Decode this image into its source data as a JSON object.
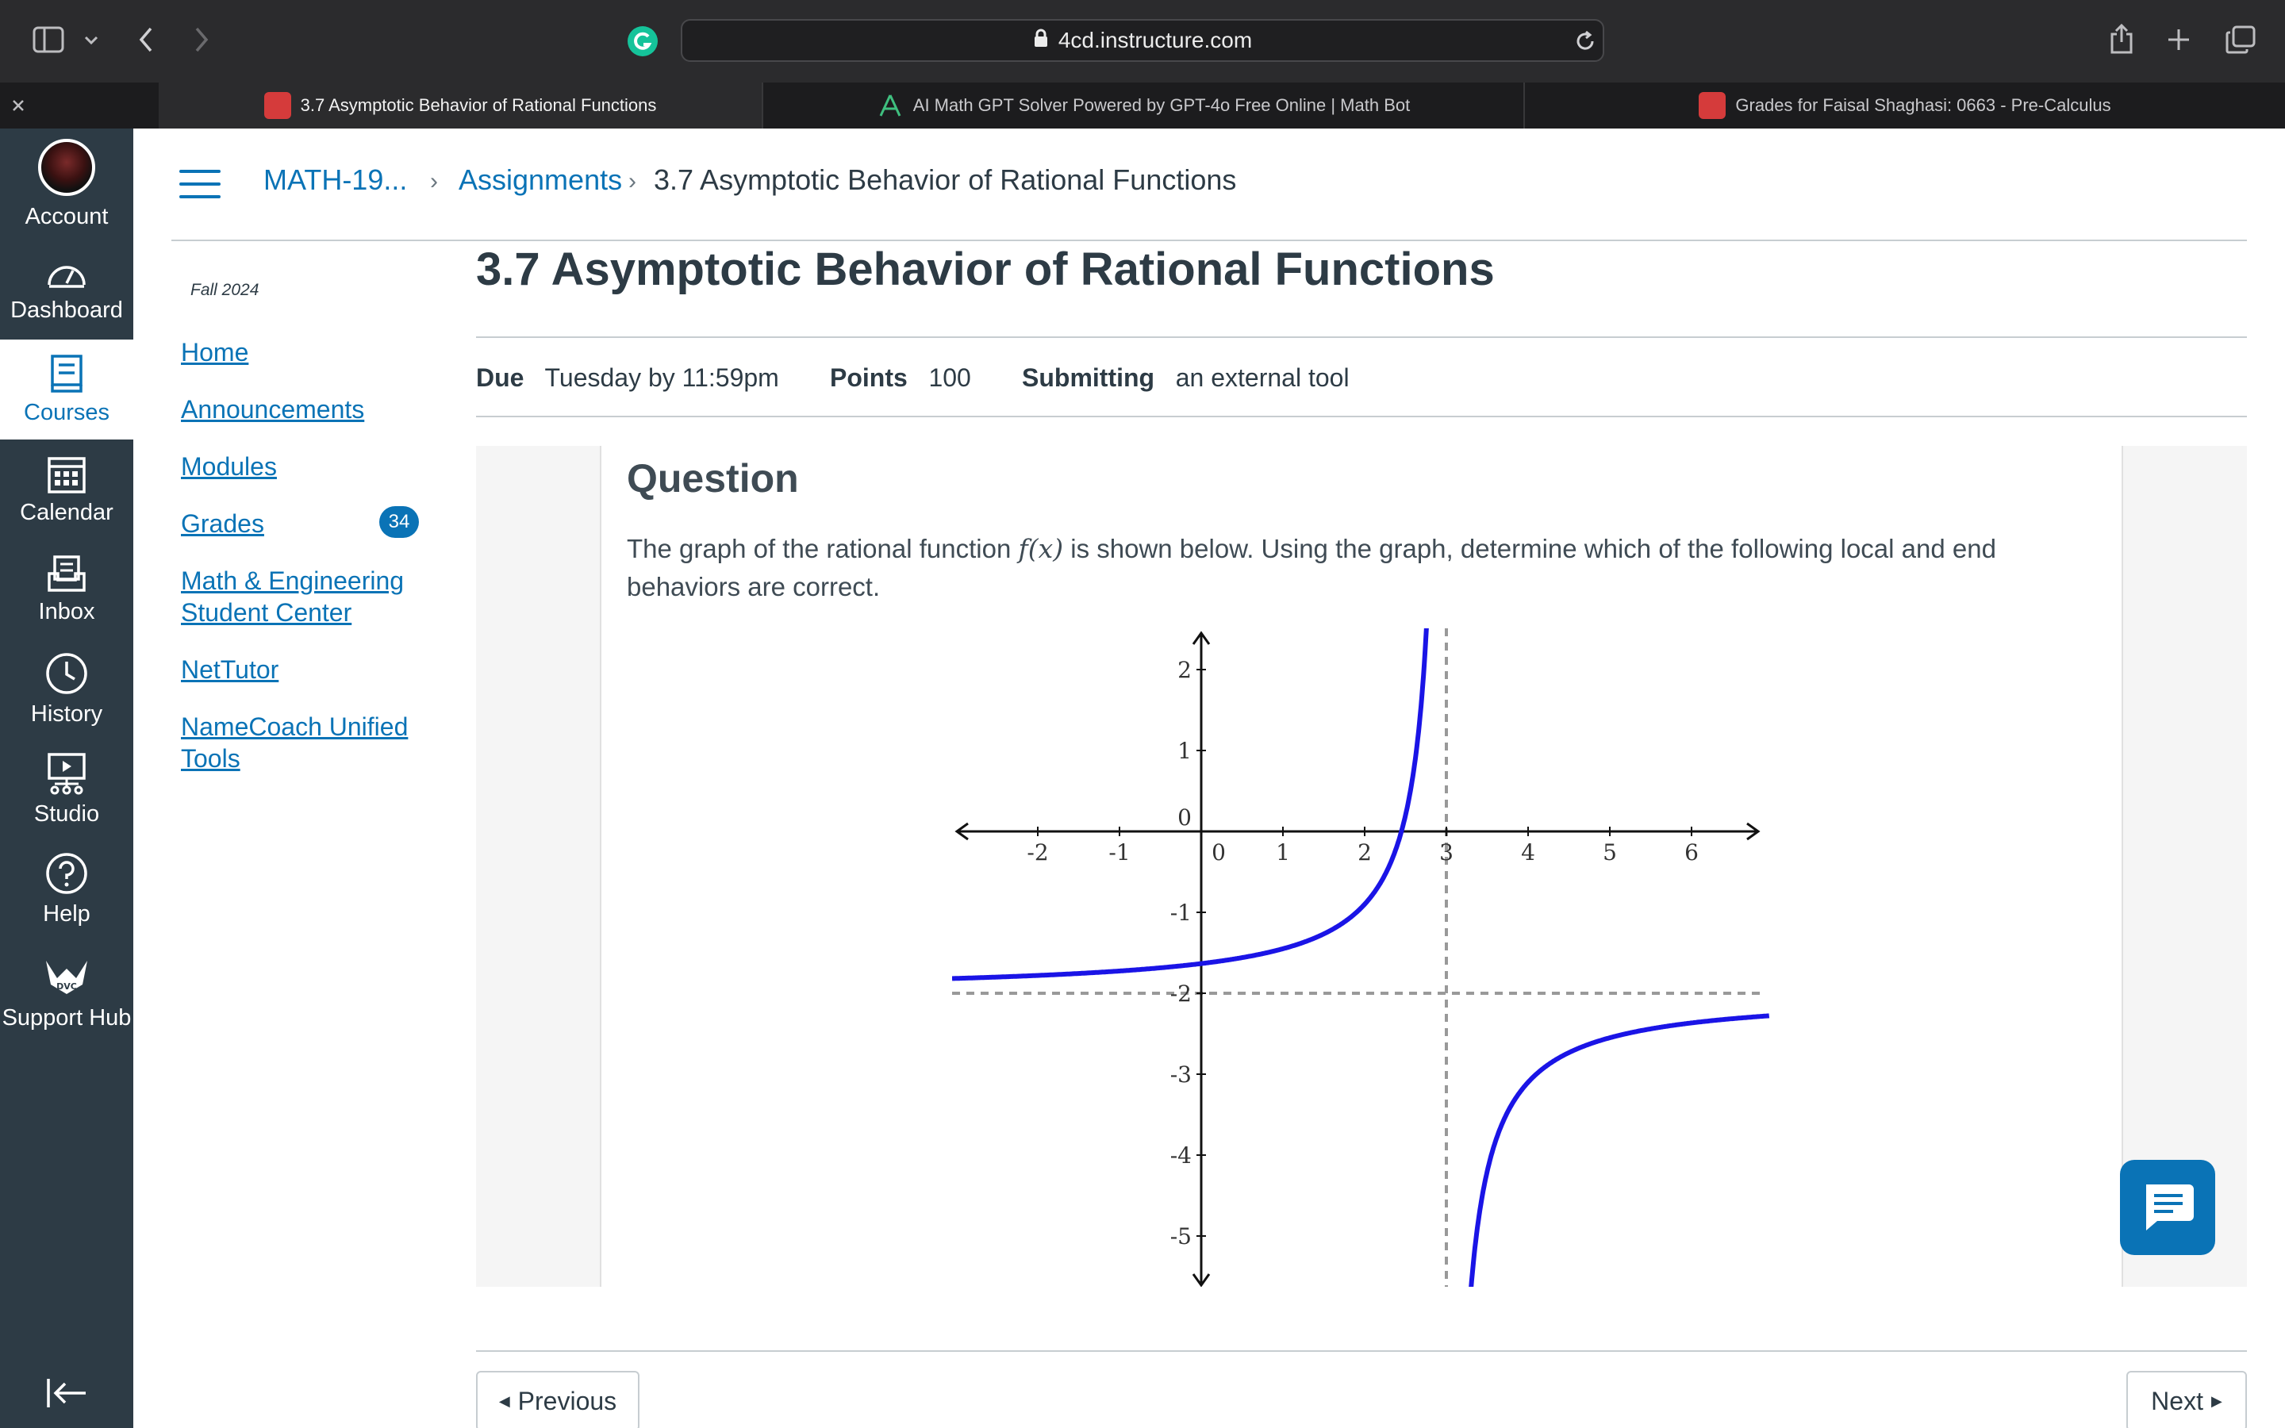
{
  "browser": {
    "url": "4cd.instructure.com",
    "tabs": [
      {
        "title": "3.7 Asymptotic Behavior of Rational Functions",
        "active": true
      },
      {
        "title": "AI Math GPT Solver Powered by GPT-4o Free Online | Math Bot",
        "active": false
      },
      {
        "title": "Grades for Faisal Shaghasi: 0663 - Pre-Calculus",
        "active": false
      }
    ]
  },
  "global_nav": {
    "items": [
      {
        "label": "Account",
        "icon": "avatar"
      },
      {
        "label": "Dashboard",
        "icon": "dashboard-icon"
      },
      {
        "label": "Courses",
        "icon": "courses-icon"
      },
      {
        "label": "Calendar",
        "icon": "calendar-icon"
      },
      {
        "label": "Inbox",
        "icon": "inbox-icon"
      },
      {
        "label": "History",
        "icon": "history-icon"
      },
      {
        "label": "Studio",
        "icon": "studio-icon"
      },
      {
        "label": "Help",
        "icon": "help-icon"
      },
      {
        "label": "Support Hub",
        "icon": "dvc-logo"
      }
    ],
    "active": "Courses"
  },
  "breadcrumb": {
    "course": "MATH-19...",
    "section": "Assignments",
    "current": "3.7 Asymptotic Behavior of Rational Functions"
  },
  "course_nav": {
    "term": "Fall 2024",
    "items": [
      {
        "label": "Home"
      },
      {
        "label": "Announcements"
      },
      {
        "label": "Modules"
      },
      {
        "label": "Grades",
        "badge": "34"
      },
      {
        "label": "Math & Engineering Student Center"
      },
      {
        "label": "NetTutor"
      },
      {
        "label": "NameCoach Unified Tools"
      }
    ]
  },
  "assignment": {
    "title": "3.7 Asymptotic Behavior of Rational Functions",
    "due_label": "Due",
    "due_value": "Tuesday by 11:59pm",
    "points_label": "Points",
    "points_value": "100",
    "submitting_label": "Submitting",
    "submitting_value": "an external tool"
  },
  "question": {
    "heading": "Question",
    "text_before": "The graph of the rational function ",
    "func": "f(x)",
    "text_after": " is shown below. Using the graph, determine which of the following local and end behaviors are correct."
  },
  "graph": {
    "x_ticks": [
      "-2",
      "-1",
      "0",
      "1",
      "2",
      "3",
      "4",
      "5",
      "6"
    ],
    "y_ticks": [
      "2",
      "1",
      "0",
      "-1",
      "-2",
      "-3",
      "-4",
      "-5"
    ],
    "vertical_asymptote": 3,
    "horizontal_asymptote": -2,
    "curve_color": "#1a14e6"
  },
  "footer": {
    "previous": "Previous",
    "next": "Next"
  },
  "colors": {
    "link": "#0a73b6",
    "nav_bg": "#2d3b45"
  }
}
